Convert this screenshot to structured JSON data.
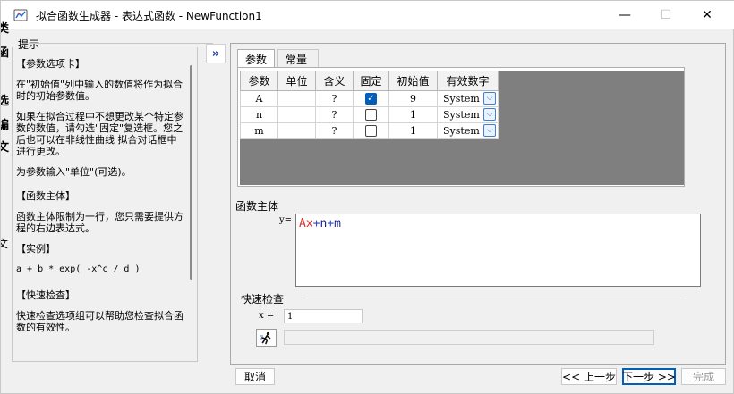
{
  "window": {
    "title": "拟合函数生成器 - 表达式函数 - NewFunction1",
    "minimize_glyph": "—",
    "maximize_glyph": "☐",
    "close_glyph": "✕"
  },
  "background_edge": [
    "类",
    "函",
    "选",
    "编",
    "文",
    "文作"
  ],
  "hint": {
    "label": "提示",
    "sections": [
      "【参数选项卡】",
      "在\"初始值\"列中输入的数值将作为拟合时的初始参数值。",
      "如果在拟合过程中不想更改某个特定参数的数值，请勾选\"固定\"复选框。您之后也可以在非线性曲线 拟合对话框中进行更改。",
      "为参数输入\"单位\"(可选)。",
      "【函数主体】",
      "函数主体限制为一行，您只需要提供方程的右边表达式。",
      "【实例】",
      "a + b * exp( -x^c / d )",
      "【快速检查】",
      "快速检查选项组可以帮助您检查拟合函数的有效性。"
    ]
  },
  "collapse_button": "»",
  "tabs": [
    {
      "label": "参数",
      "active": true
    },
    {
      "label": "常量",
      "active": false
    }
  ],
  "params_table": {
    "headers": [
      "参数",
      "单位",
      "含义",
      "固定",
      "初始值",
      "有效数字"
    ],
    "rows": [
      {
        "name": "A",
        "unit": "",
        "meaning": "?",
        "fixed": true,
        "initial": "9",
        "sig": "System"
      },
      {
        "name": "n",
        "unit": "",
        "meaning": "?",
        "fixed": false,
        "initial": "1",
        "sig": "System"
      },
      {
        "name": "m",
        "unit": "",
        "meaning": "?",
        "fixed": false,
        "initial": "1",
        "sig": "System"
      }
    ]
  },
  "function_body": {
    "label": "函数主体",
    "lhs": "y=",
    "expr": {
      "t1": "Ax",
      "op1": "+",
      "t2": "n",
      "op2": "+",
      "t3": "m"
    }
  },
  "quick_check": {
    "label": "快速检查",
    "x_label": "x =",
    "x_value": "1",
    "result": ""
  },
  "buttons": {
    "cancel": "取消",
    "prev": "<< 上一步",
    "next": "下一步 >>",
    "finish": "完成"
  },
  "colors": {
    "accent": "#005fb8",
    "param_color": "#e0302a",
    "operator_color": "#3047d0"
  }
}
